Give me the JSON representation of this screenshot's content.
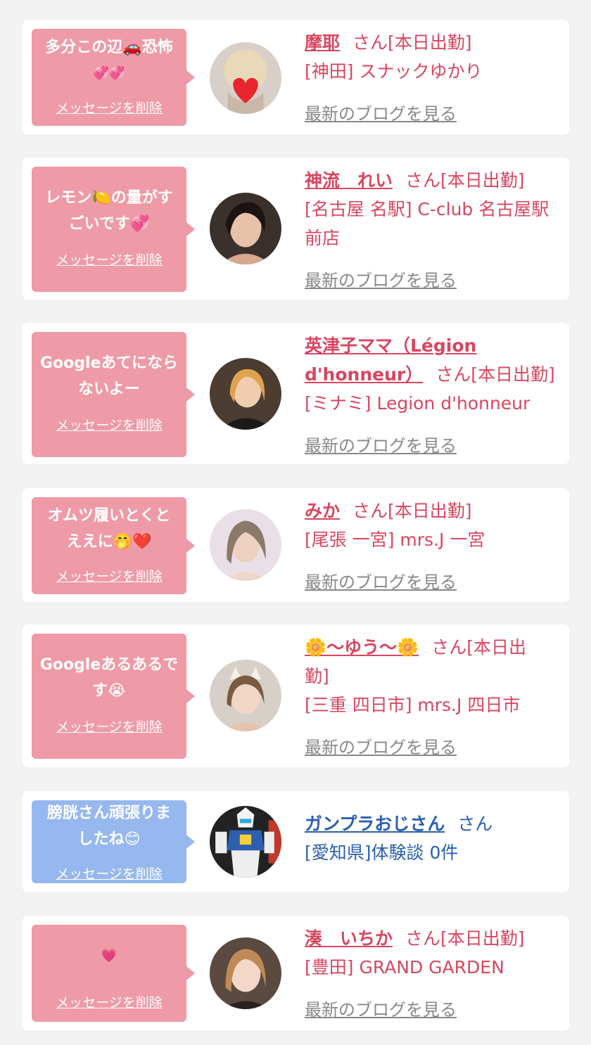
{
  "items": [
    {
      "message": "多分この辺🚗恐怖",
      "message2": "💞💞",
      "delete_label": "メッセージを削除",
      "name": "摩耶",
      "suffix": "さん[本日出勤]",
      "shop": "[神田] スナックゆかり",
      "blog_label": "最新のブログを見る"
    },
    {
      "message": "レモン🍋の量がす",
      "message2": "ごいです💞",
      "delete_label": "メッセージを削除",
      "name": "神流　れい",
      "suffix": "さん[本日出勤]",
      "shop": "[名古屋 名駅] C-club 名古屋駅",
      "shop2": "前店",
      "blog_label": "最新のブログを見る"
    },
    {
      "message": "Googleあてになら",
      "message2": "ないよー",
      "delete_label": "メッセージを削除",
      "name": "英津子ママ（Légion",
      "name2": "d'honneur）",
      "suffix": "さん[本日出勤]",
      "shop": "[ミナミ] Legion d'honneur",
      "blog_label": "最新のブログを見る"
    },
    {
      "message": "オムツ履いとくと",
      "message2": "ええに🤭❤️",
      "delete_label": "メッセージを削除",
      "name": "みか",
      "suffix": "さん[本日出勤]",
      "shop": "[尾張 一宮] mrs.J 一宮",
      "blog_label": "最新のブログを見る"
    },
    {
      "message": "Googleあるあるで",
      "message2": "す😭",
      "delete_label": "メッセージを削除",
      "name": "🌼～ゆう～🌼",
      "suffix": "さん[本日出",
      "suffix2": "勤]",
      "shop": "[三重 四日市] mrs.J 四日市",
      "blog_label": "最新のブログを見る"
    },
    {
      "message": "膀胱さん頑張りま",
      "message2": "したね😊",
      "delete_label": "メッセージを削除",
      "name": "ガンプラおじさん",
      "suffix": "さん",
      "shop": "[愛知県]体験談 0件"
    },
    {
      "message": "💗",
      "delete_label": "メッセージを削除",
      "name": "湊　いちか",
      "suffix": "さん[本日出勤]",
      "shop": "[豊田] GRAND GARDEN",
      "blog_label": "最新のブログを見る"
    }
  ]
}
